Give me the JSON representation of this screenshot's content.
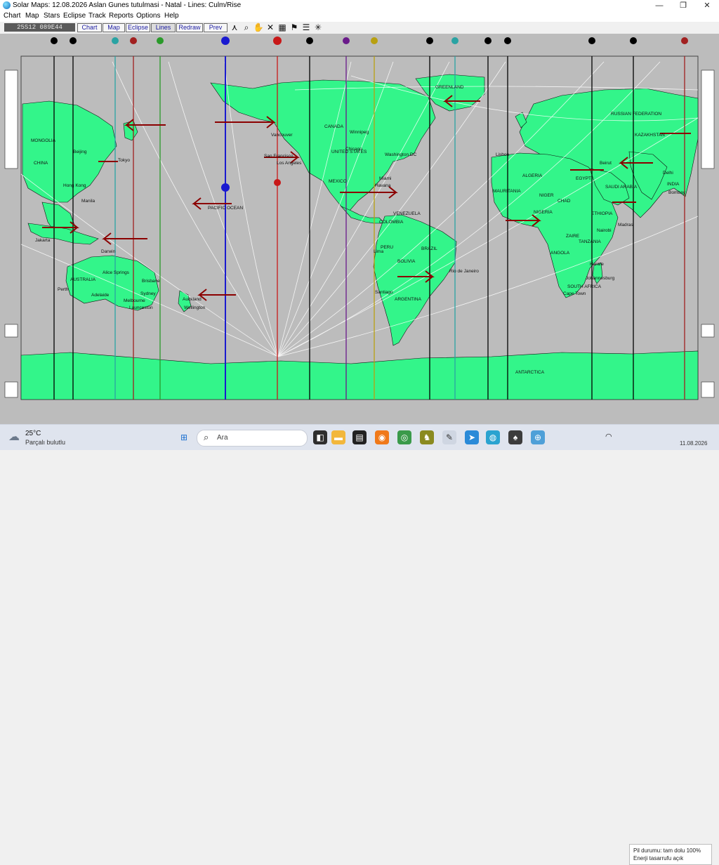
{
  "window": {
    "title": "Solar Maps: 12.08.2026 Aslan Gunes tutulmasi - Natal - Lines: Culm/Rise",
    "minimize": "—",
    "maximize": "❐",
    "close": "✕"
  },
  "menu": [
    "Chart",
    "Map",
    "Stars",
    "Eclipse",
    "Track",
    "Reports",
    "Options",
    "Help"
  ],
  "toolbar": {
    "coords": "25S12  089E44",
    "buttons": [
      "Chart",
      "Map",
      "Eclipse",
      "Lines",
      "Redraw",
      "Prev"
    ],
    "active_button": "Lines",
    "icons": [
      "figure-icon",
      "zoom-icon",
      "hand-icon",
      "no-lines-icon",
      "grid-icon",
      "flag-icon",
      "list-icon",
      "cross-icon"
    ]
  },
  "map": {
    "ocean_color": "#bcbcbc",
    "land_color": "#33f58a",
    "place_labels": [
      "MONGOLIA",
      "CHINA",
      "Beijing",
      "Tokyo",
      "Hong Kong",
      "Manila",
      "Jakarta",
      "Darwin",
      "AUSTRALIA",
      "Alice Springs",
      "Brisbane",
      "Perth",
      "Adelaide",
      "Sydney",
      "Melbourne",
      "Launceston",
      "Auckland",
      "Wellington",
      "PACIFIC OCEAN",
      "Vancouver",
      "CANADA",
      "Winnipeg",
      "San Francisco",
      "Los Angeles",
      "UNITED STATES",
      "Chicago",
      "Washington DC",
      "MEXICO",
      "Miami",
      "Havana",
      "VENEZUELA",
      "COLOMBIA",
      "PERU",
      "Lima",
      "BRAZIL",
      "BOLIVIA",
      "Rio de Janeiro",
      "Santiago",
      "ARGENTINA",
      "GREENLAND",
      "Lisbon",
      "ALGERIA",
      "MAURITANIA",
      "NIGER",
      "CHAD",
      "NIGERIA",
      "EGYPT",
      "SAUDI ARABIA",
      "ETHIOPIA",
      "Nairobi",
      "ZAIRE",
      "TANZANIA",
      "ANGOLA",
      "Harare",
      "Johannesburg",
      "SOUTH AFRICA",
      "Cape Town",
      "RUSSIAN FEDERATION",
      "KAZAKHSTAN",
      "Delhi",
      "INDIA",
      "Bombay",
      "Beirut",
      "Madras",
      "ANTARCTICA"
    ]
  },
  "taskbar": {
    "temperature": "25°C",
    "condition": "Parçalı bulutlu",
    "search_placeholder": "Ara",
    "battery_line1": "Pil durumu: tam dolu 100%",
    "battery_line2": "Enerji tasarrufu açık",
    "clock": "11.08.2026"
  }
}
